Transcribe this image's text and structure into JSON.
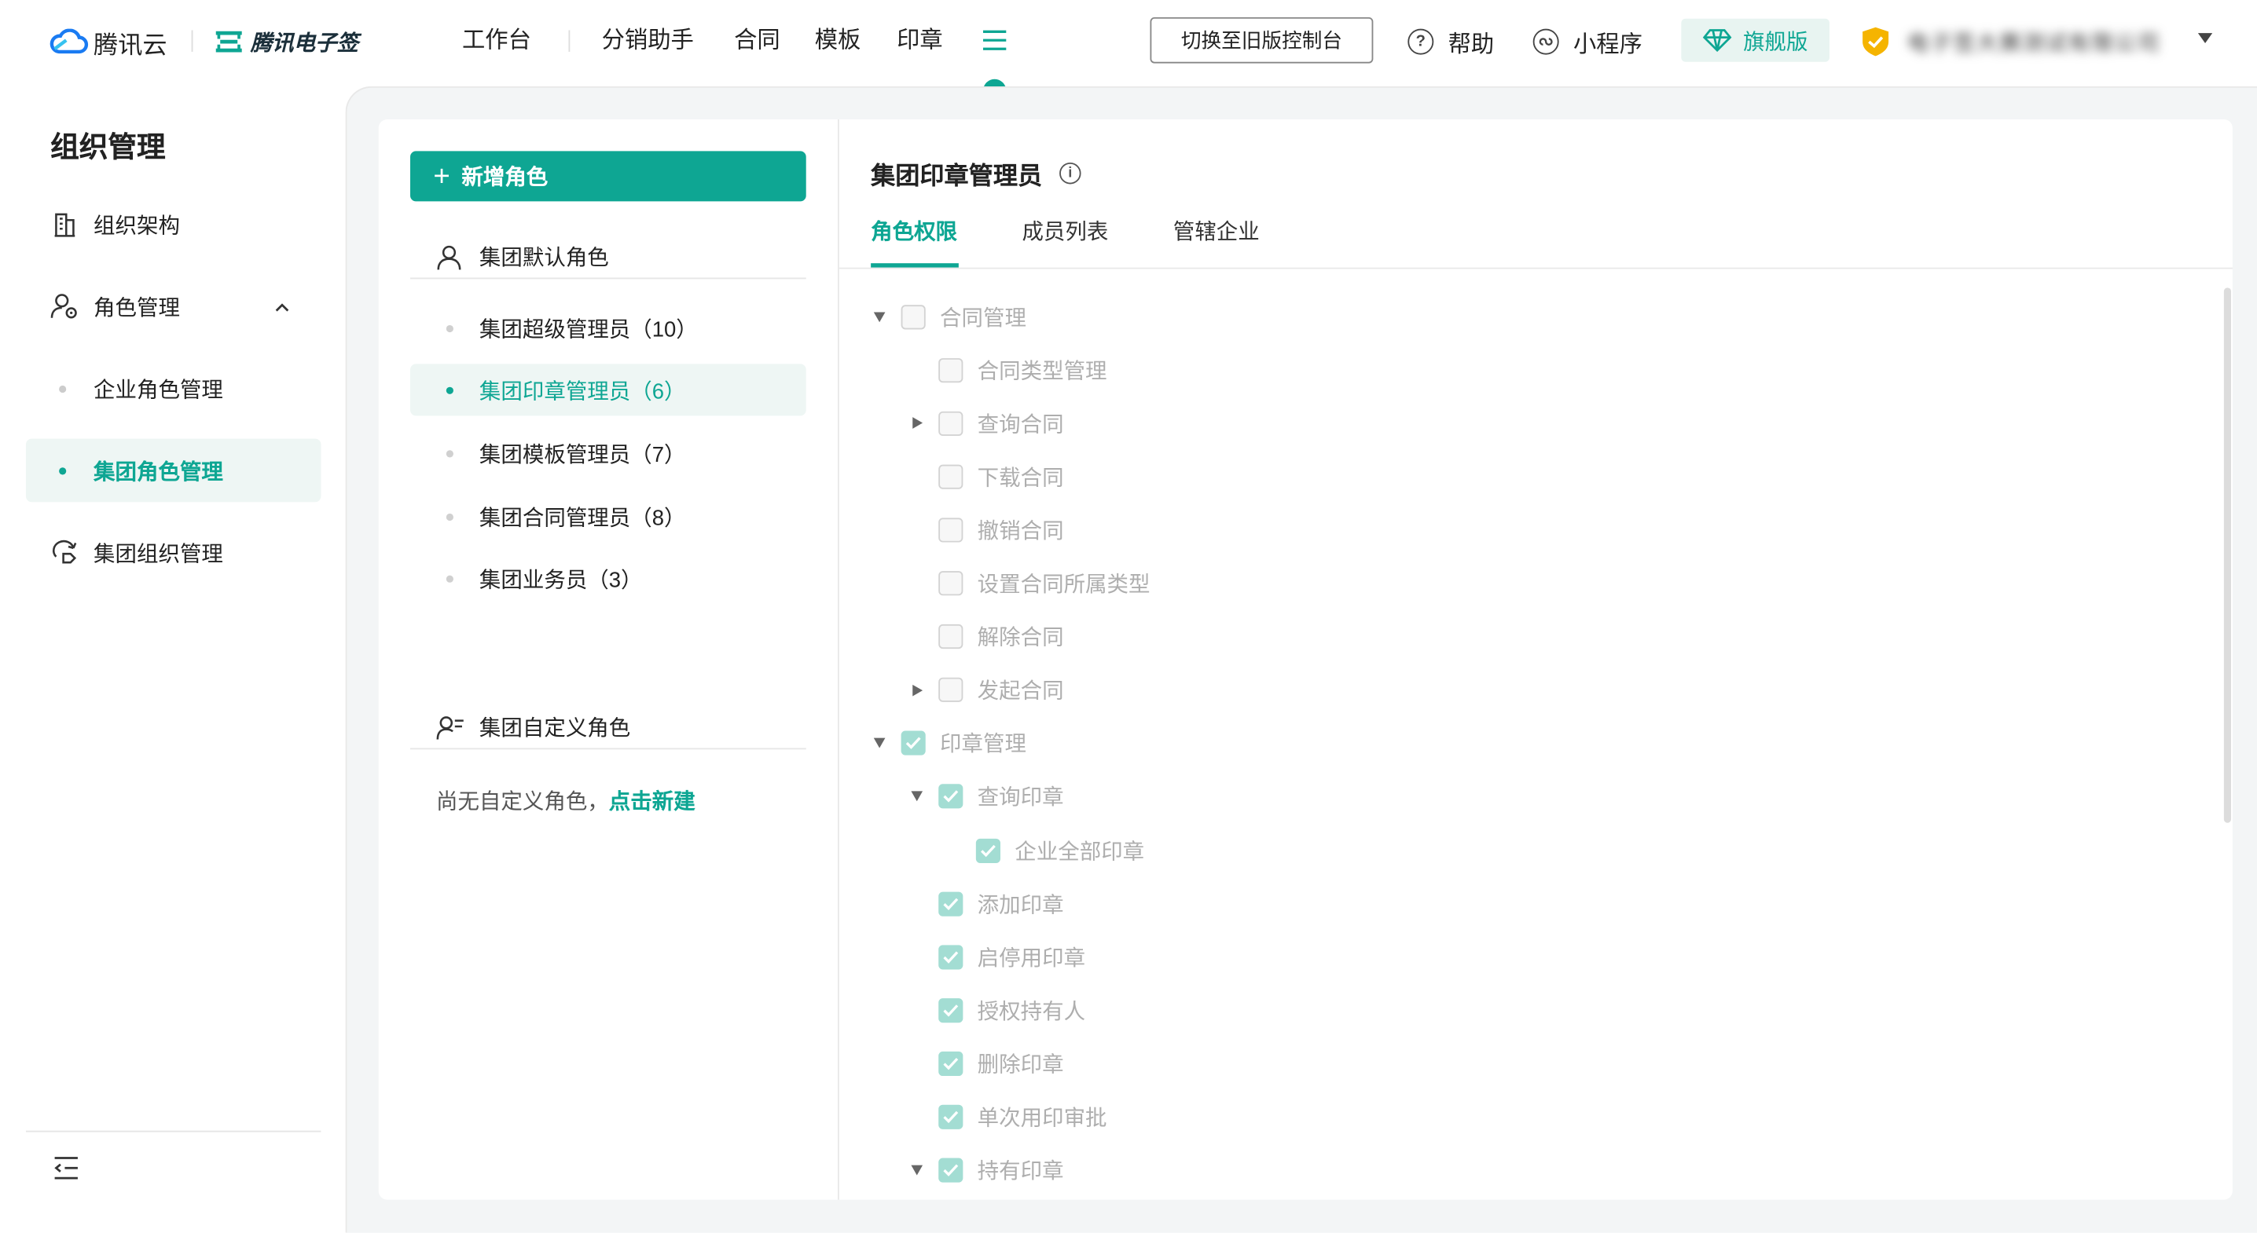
{
  "header": {
    "brand_cloud": "腾讯云",
    "brand_sign": "腾讯电子签",
    "nav": [
      "工作台",
      "分销助手",
      "合同",
      "模板",
      "印章"
    ],
    "switch_label": "切换至旧版控制台",
    "help_label": "帮助",
    "miniprogram_label": "小程序",
    "edition_label": "旗舰版",
    "company_name": "电子签大赛测试有限公司",
    "accent": "#0ea693"
  },
  "sidebar": {
    "title": "组织管理",
    "items": [
      {
        "label": "组织架构",
        "icon": "building-icon"
      },
      {
        "label": "角色管理",
        "icon": "role-icon"
      },
      {
        "label": "企业角色管理"
      },
      {
        "label": "集团角色管理"
      },
      {
        "label": "集团组织管理",
        "icon": "group-org-icon"
      }
    ]
  },
  "roles": {
    "add_label": "新增角色",
    "default_group_title": "集团默认角色",
    "default_roles": [
      "集团超级管理员（10）",
      "集团印章管理员（6）",
      "集团模板管理员（7）",
      "集团合同管理员（8）",
      "集团业务员（3）"
    ],
    "custom_group_title": "集团自定义角色",
    "empty_prefix": "尚无自定义角色，",
    "empty_link": "点击新建"
  },
  "detail": {
    "title": "集团印章管理员",
    "tabs": [
      "角色权限",
      "成员列表",
      "管辖企业"
    ],
    "permissions": [
      {
        "label": "合同管理",
        "level": 0,
        "expander": "down",
        "checked": false
      },
      {
        "label": "合同类型管理",
        "level": 1,
        "expander": "none",
        "checked": false
      },
      {
        "label": "查询合同",
        "level": 1,
        "expander": "right",
        "checked": false
      },
      {
        "label": "下载合同",
        "level": 1,
        "expander": "none",
        "checked": false
      },
      {
        "label": "撤销合同",
        "level": 1,
        "expander": "none",
        "checked": false
      },
      {
        "label": "设置合同所属类型",
        "level": 1,
        "expander": "none",
        "checked": false
      },
      {
        "label": "解除合同",
        "level": 1,
        "expander": "none",
        "checked": false
      },
      {
        "label": "发起合同",
        "level": 1,
        "expander": "right",
        "checked": false
      },
      {
        "label": "印章管理",
        "level": 0,
        "expander": "down",
        "checked": true
      },
      {
        "label": "查询印章",
        "level": 1,
        "expander": "down",
        "checked": true
      },
      {
        "label": "企业全部印章",
        "level": 2,
        "expander": "none",
        "checked": true
      },
      {
        "label": "添加印章",
        "level": 1,
        "expander": "none",
        "checked": true
      },
      {
        "label": "启停用印章",
        "level": 1,
        "expander": "none",
        "checked": true
      },
      {
        "label": "授权持有人",
        "level": 1,
        "expander": "none",
        "checked": true
      },
      {
        "label": "删除印章",
        "level": 1,
        "expander": "none",
        "checked": true
      },
      {
        "label": "单次用印审批",
        "level": 1,
        "expander": "none",
        "checked": true
      },
      {
        "label": "持有印章",
        "level": 1,
        "expander": "down",
        "checked": true
      }
    ]
  }
}
